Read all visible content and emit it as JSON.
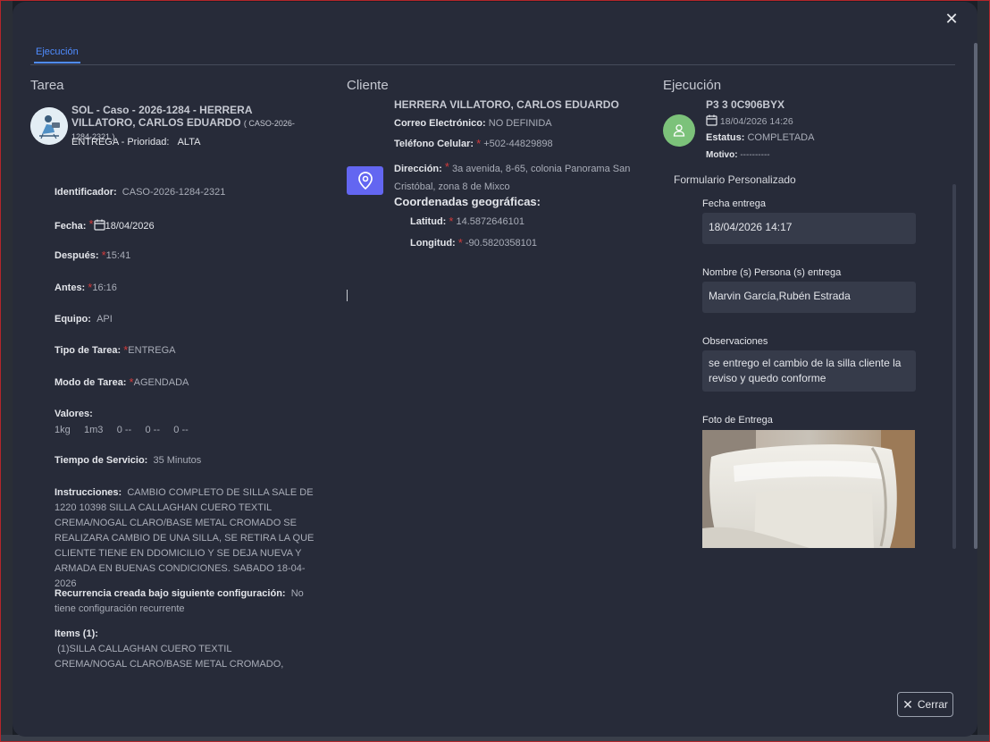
{
  "tabs": [
    {
      "label": "Ejecución"
    }
  ],
  "tarea": {
    "section_title": "Tarea",
    "name_line": "SOL - Caso - 2026-1284 - HERRERA VILLATORO, CARLOS EDUARDO",
    "case_code": "( CASO-2026-1284-2321 )",
    "type_priority_label": "ENTREGA - Prioridad:",
    "priority": "ALTA",
    "identificador_label": "Identificador:",
    "identificador": "CASO-2026-1284-2321",
    "fecha_label": "Fecha:",
    "fecha": "18/04/2026",
    "despues_label": "Después:",
    "despues": "15:41",
    "antes_label": "Antes:",
    "antes": "16:16",
    "equipo_label": "Equipo:",
    "equipo": "API",
    "tipo_label": "Tipo de Tarea:",
    "tipo": "ENTREGA",
    "modo_label": "Modo de Tarea:",
    "modo": "AGENDADA",
    "valores_label": "Valores:",
    "valores": [
      "1kg",
      "1m3",
      "0 --",
      "0 --",
      "0 --"
    ],
    "tiempo_label": "Tiempo de Servicio:",
    "tiempo": "35 Minutos",
    "instrucciones_label": "Instrucciones:",
    "instrucciones": "CAMBIO COMPLETO DE SILLA SALE DE 1220 10398 SILLA CALLAGHAN CUERO TEXTIL CREMA/NOGAL CLARO/BASE METAL CROMADO SE REALIZARA CAMBIO DE UNA SILLA, SE RETIRA LA QUE CLIENTE TIENE EN DDOMICILIO Y SE DEJA NUEVA Y ARMADA EN BUENAS CONDICIONES. SABADO 18-04-2026",
    "recurrencia_label": "Recurrencia creada bajo siguiente configuración:",
    "recurrencia": "No tiene configuración recurrente",
    "items_label": "Items (1):",
    "items": "(1)SILLA CALLAGHAN CUERO TEXTIL CREMA/NOGAL CLARO/BASE METAL CROMADO,"
  },
  "cliente": {
    "section_title": "Cliente",
    "name": "HERRERA VILLATORO, CARLOS EDUARDO",
    "correo_label": "Correo Electrónico:",
    "correo": "NO DEFINIDA",
    "telefono_label": "Teléfono Celular:",
    "telefono": "+502-44829898",
    "direccion_label": "Dirección:",
    "direccion": "3a avenida, 8-65, colonia Panorama San Cristóbal, zona 8 de Mixco",
    "geo_title": "Coordenadas geográficas:",
    "latitud_label": "Latitud:",
    "latitud": "14.5872646101",
    "longitud_label": "Longitud:",
    "longitud": "-90.5820358101"
  },
  "ejecucion": {
    "section_title": "Ejecución",
    "plate": "P3 3 0C906BYX",
    "datetime": "18/04/2026 14:26",
    "estatus_label": "Estatus:",
    "estatus": "COMPLETADA",
    "motivo_label": "Motivo:",
    "motivo": "----------",
    "form_title": "Formulario Personalizado",
    "fecha_entrega_label": "Fecha entrega",
    "fecha_entrega": "18/04/2026 14:17",
    "nombre_label": "Nombre (s) Persona (s) entrega",
    "nombre": "Marvin García,Rubén Estrada",
    "observaciones_label": "Observaciones",
    "observaciones": "se entrego el cambio de la silla cliente la reviso y quedo conforme",
    "foto_label": "Foto de Entrega"
  },
  "footer": {
    "cerrar_label": "Cerrar"
  },
  "colors": {
    "accent": "#4f8cff",
    "required": "#d23b3b",
    "location": "#6366f1",
    "avatar": "#7cc27a"
  },
  "icons": [
    "close-icon",
    "calendar-icon",
    "location-pin-icon",
    "user-icon"
  ]
}
